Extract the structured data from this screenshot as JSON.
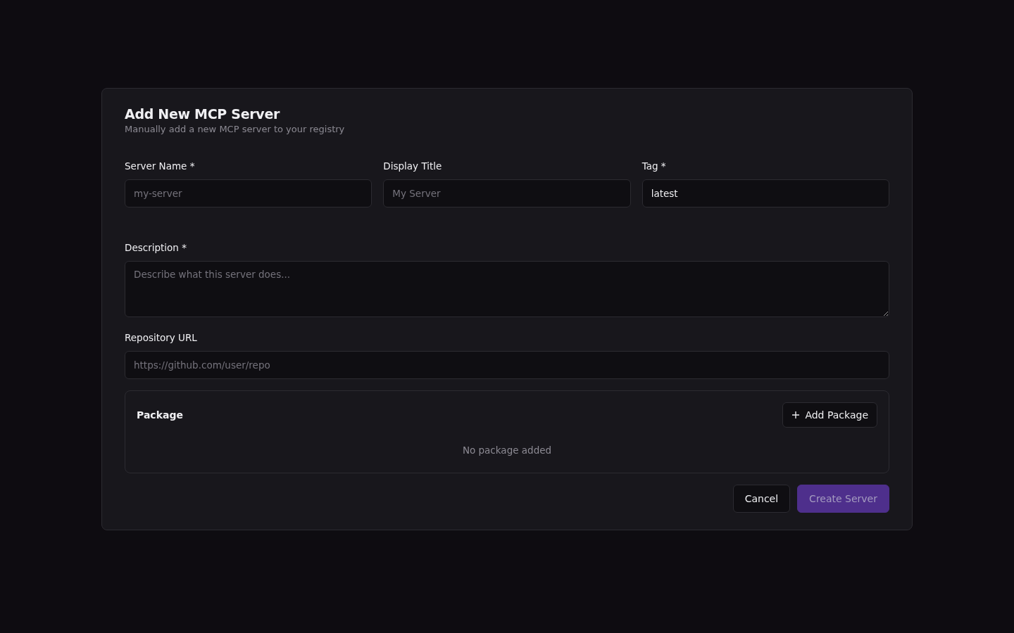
{
  "dialog": {
    "title": "Add New MCP Server",
    "subtitle": "Manually add a new MCP server to your registry",
    "fields": [
      {
        "kind": "input",
        "label": "Server Name *",
        "placeholder": "my-server"
      },
      {
        "kind": "input",
        "label": "Display Title",
        "placeholder": "My Server"
      },
      {
        "kind": "input",
        "label": "Tag *",
        "value": "latest"
      },
      {
        "kind": "textarea",
        "label": "Description *",
        "placeholder": "Describe what this server does..."
      },
      {
        "kind": "input",
        "label": "Repository URL",
        "placeholder": "https://github.com/user/repo"
      }
    ],
    "package": {
      "title": "Package",
      "add_button": "Add Package",
      "empty_text": "No package added"
    },
    "buttons": [
      {
        "kind": "secondary",
        "label": "Cancel",
        "disabled": false
      },
      {
        "kind": "primary",
        "label": "Create Server",
        "disabled": true
      }
    ]
  }
}
